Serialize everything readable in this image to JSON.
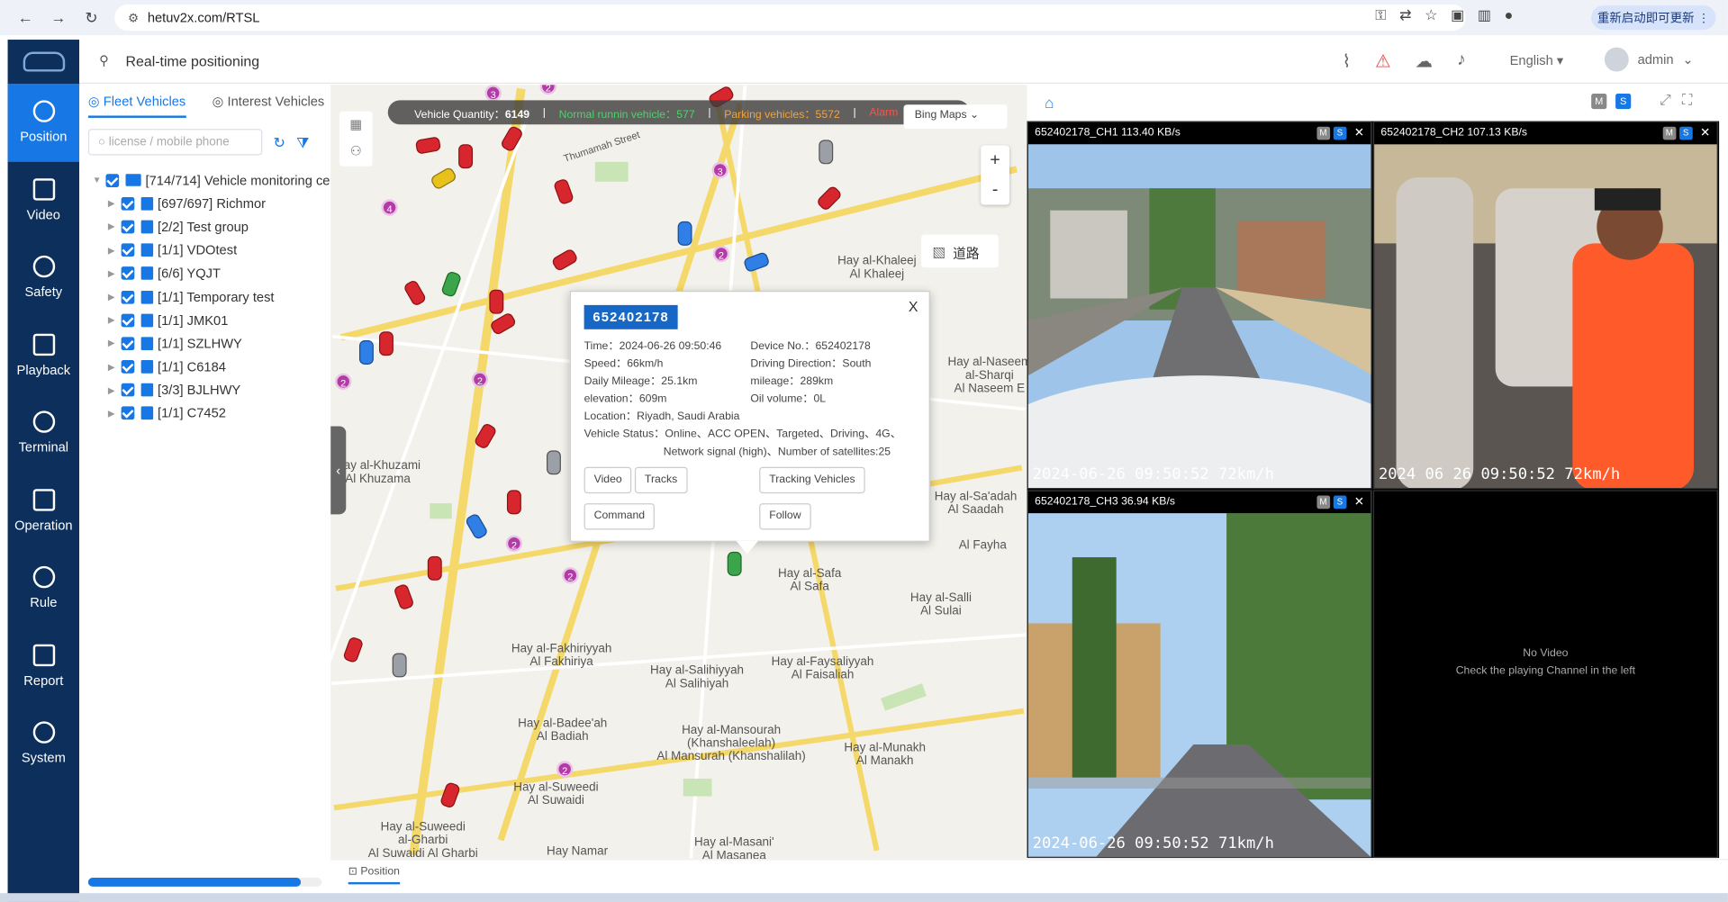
{
  "browser": {
    "url": "hetuv2x.com/RTSL",
    "update_label": "重新启动即可更新"
  },
  "sidebar": {
    "items": [
      {
        "label": "Position",
        "icon": "location-icon",
        "active": true
      },
      {
        "label": "Video",
        "icon": "video-icon"
      },
      {
        "label": "Safety",
        "icon": "safety-icon"
      },
      {
        "label": "Playback",
        "icon": "playback-icon"
      },
      {
        "label": "Terminal",
        "icon": "terminal-icon"
      },
      {
        "label": "Operation",
        "icon": "chart-icon"
      },
      {
        "label": "Rule",
        "icon": "rule-icon"
      },
      {
        "label": "Report",
        "icon": "report-icon"
      },
      {
        "label": "System",
        "icon": "gear-icon"
      }
    ]
  },
  "header": {
    "title": "Real-time positioning",
    "language": "English",
    "user": "admin"
  },
  "left_panel": {
    "tabs": [
      "Fleet Vehicles",
      "Interest Vehicles"
    ],
    "search_placeholder": "license / mobile phone",
    "root": "[714/714] Vehicle monitoring ce",
    "groups": [
      "[697/697] Richmor",
      "[2/2] Test group",
      "[1/1] VDOtest",
      "[6/6] YQJT",
      "[1/1] Temporary test",
      "[1/1] JMK01",
      "[1/1] SZLHWY",
      "[1/1] C6184",
      "[3/3] BJLHWY",
      "[1/1] C7452"
    ],
    "scroll_fraction": 0.91
  },
  "map": {
    "stats": {
      "quantity_label": "Vehicle Quantity：",
      "quantity": "6149",
      "running": "Normal runnin vehicle：577",
      "parking": "Parking vehicles：5572",
      "alarm": "Alarm"
    },
    "layer": "Bing Maps",
    "road_label": "道路",
    "zoom_in": "+",
    "zoom_out": "-",
    "labels": [
      "Hay al-Khaleej\nAl Khaleej",
      "Hay al-Naseem\nal-Sharqi\nAl Naseem E",
      "Hay al-Khuzami\nAl Khuzama",
      "Hay al-Sa'adah\nAl Saadah",
      "Al Fayha",
      "Hay al-Safa\nAl Safa",
      "Hay al-Salli\nAl Sulai",
      "Hay al-Fakhiriyyah\nAl Fakhiriya",
      "Hay al-Salihiyyah\nAl Salihiyah",
      "Hay al-Faysaliyyah\nAl Faisaliah",
      "Hay al-Badee'ah\nAl Badiah",
      "Hay al-Mansourah\n(Khanshaleelah)\nAl Mansurah (Khanshalilah)",
      "Hay al-Munakh\nAl Manakh",
      "Hay al-Suweedi\nAl Suwaidi",
      "Hay al-Suweedi\nal-Gharbi\nAl Suwaidi Al Gharbi",
      "Hay Namar",
      "Hay al-Masani'\nAl Masanea",
      "Thumamah Street"
    ]
  },
  "popup": {
    "device_tag": "652402178",
    "close": "X",
    "time": "Time：2024-06-26 09:50:46",
    "device_no": "Device No.：652402178",
    "speed": "Speed：66km/h",
    "direction": "Driving Direction：South",
    "daily_mileage": "Daily Mileage：25.1km",
    "mileage": "mileage：289km",
    "elevation": "elevation：609m",
    "oil": "Oil volume：0L",
    "location": "Location：Riyadh, Saudi Arabia",
    "status1": "Vehicle Status：Online、ACC OPEN、Targeted、Driving、4G、",
    "status2": "Network signal (high)、Number of satellites:25",
    "buttons": [
      "Video",
      "Tracks",
      "Tracking Vehicles",
      "Command",
      "Follow"
    ]
  },
  "video": {
    "channels": [
      {
        "title": "652402178_CH1 113.40 KB/s",
        "timestamp": "2024-06-26 09:50:52 72km/h"
      },
      {
        "title": "652402178_CH2 107.13 KB/s",
        "timestamp": "2024 06 26 09:50:52 72km/h"
      },
      {
        "title": "652402178_CH3 36.94 KB/s",
        "timestamp": "2024-06-26 09:50:52 71km/h"
      }
    ],
    "empty": {
      "line1": "No Video",
      "line2": "Check the playing Channel in the left"
    },
    "m": "M",
    "s": "S",
    "x": "✕"
  },
  "bottom_tab": "Position"
}
